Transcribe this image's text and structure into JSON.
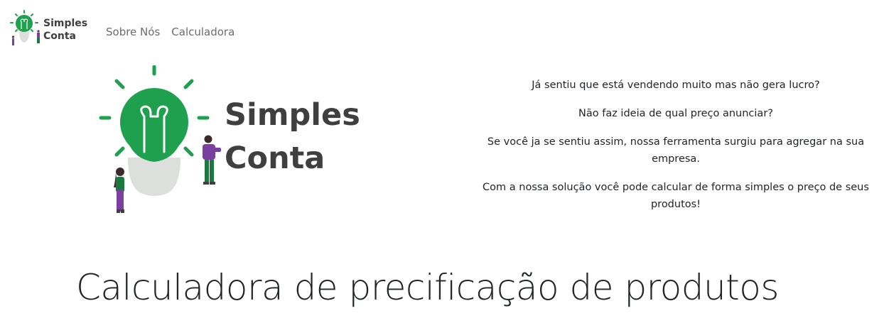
{
  "navbar": {
    "brand": {
      "line1": "Simples",
      "line2": "Conta"
    },
    "links": [
      {
        "label": "Sobre Nós"
      },
      {
        "label": "Calculadora"
      }
    ]
  },
  "hero": {
    "logo": {
      "line1": "Simples",
      "line2": "Conta"
    },
    "intro": [
      "Já sentiu que está vendendo muito mas não gera lucro?",
      "Não faz ideia de qual preço anunciar?",
      "Se você ja se sentiu assim, nossa ferramenta surgiu para agregar na sua empresa.",
      "Com a nossa solução você pode calcular de forma simples o preço de seus produtos!"
    ]
  },
  "calculator": {
    "title": "Calculadora de precificação de produtos"
  },
  "colors": {
    "brand_green": "#1ea04e",
    "bulb_grey": "#dcdfdc",
    "figure_purple": "#7b3fa0",
    "text_dark": "#3f3f3f"
  }
}
